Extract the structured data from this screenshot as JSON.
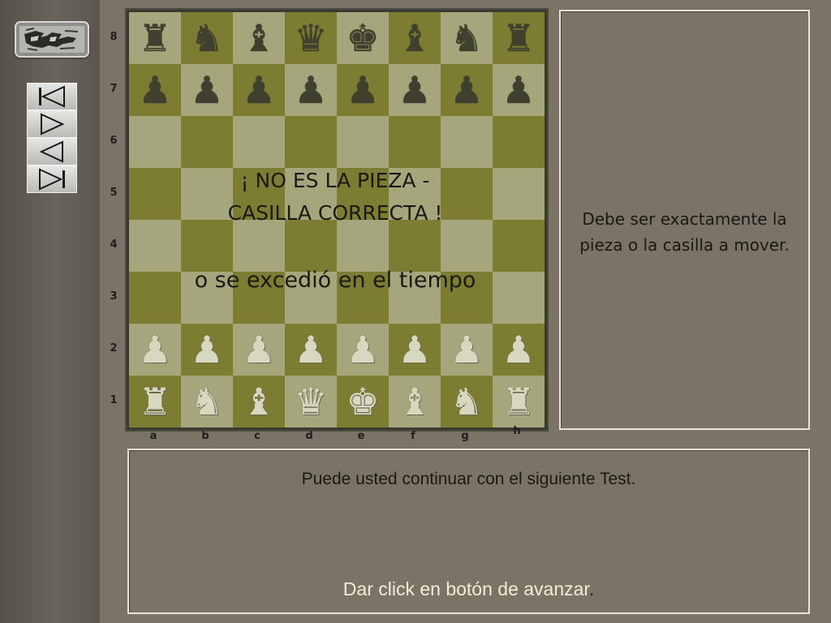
{
  "board": {
    "ranks": [
      "8",
      "7",
      "6",
      "5",
      "4",
      "3",
      "2",
      "1"
    ],
    "files": [
      "a",
      "b",
      "c",
      "d",
      "e",
      "f",
      "g",
      "h"
    ],
    "rows": [
      [
        {
          "glyph": "♜",
          "side": "black"
        },
        {
          "glyph": "♞",
          "side": "black"
        },
        {
          "glyph": "♝",
          "side": "black"
        },
        {
          "glyph": "♛",
          "side": "black"
        },
        {
          "glyph": "♚",
          "side": "black"
        },
        {
          "glyph": "♝",
          "side": "black"
        },
        {
          "glyph": "♞",
          "side": "black"
        },
        {
          "glyph": "♜",
          "side": "black"
        }
      ],
      [
        {
          "glyph": "♟",
          "side": "black"
        },
        {
          "glyph": "♟",
          "side": "black"
        },
        {
          "glyph": "♟",
          "side": "black"
        },
        {
          "glyph": "♟",
          "side": "black"
        },
        {
          "glyph": "♟",
          "side": "black"
        },
        {
          "glyph": "♟",
          "side": "black"
        },
        {
          "glyph": "♟",
          "side": "black"
        },
        {
          "glyph": "♟",
          "side": "black"
        }
      ],
      [
        null,
        null,
        null,
        null,
        null,
        null,
        null,
        null
      ],
      [
        null,
        null,
        null,
        null,
        null,
        null,
        null,
        null
      ],
      [
        null,
        null,
        null,
        null,
        null,
        null,
        null,
        null
      ],
      [
        null,
        null,
        null,
        null,
        null,
        null,
        null,
        null
      ],
      [
        {
          "glyph": "♟",
          "side": "white"
        },
        {
          "glyph": "♟",
          "side": "white"
        },
        {
          "glyph": "♟",
          "side": "white"
        },
        {
          "glyph": "♟",
          "side": "white"
        },
        {
          "glyph": "♟",
          "side": "white"
        },
        {
          "glyph": "♟",
          "side": "white"
        },
        {
          "glyph": "♟",
          "side": "white"
        },
        {
          "glyph": "♟",
          "side": "white"
        }
      ],
      [
        {
          "glyph": "♜",
          "side": "white"
        },
        {
          "glyph": "♞",
          "side": "white"
        },
        {
          "glyph": "♝",
          "side": "white"
        },
        {
          "glyph": "♛",
          "side": "white"
        },
        {
          "glyph": "♚",
          "side": "white"
        },
        {
          "glyph": "♝",
          "side": "white"
        },
        {
          "glyph": "♞",
          "side": "white"
        },
        {
          "glyph": "♜",
          "side": "white"
        }
      ]
    ]
  },
  "overlay": {
    "line1": "¡ NO ES LA PIEZA -",
    "line2": "CASILLA CORRECTA !",
    "line3": "o se excedió en el tiempo"
  },
  "side_panel": {
    "text": "Debe ser exactamente la pieza o la casilla a mover."
  },
  "bottom_panel": {
    "message": "Puede usted continuar con el siguiente Test.",
    "instruction": "Dar click en botón de avanzar",
    "instruction_end": "."
  },
  "nav": {
    "icons": [
      "first-icon",
      "next-icon",
      "previous-icon",
      "last-icon"
    ]
  },
  "colors": {
    "light_square": "#a6a67c",
    "dark_square": "#7c7c32",
    "background": "#7b7365"
  }
}
